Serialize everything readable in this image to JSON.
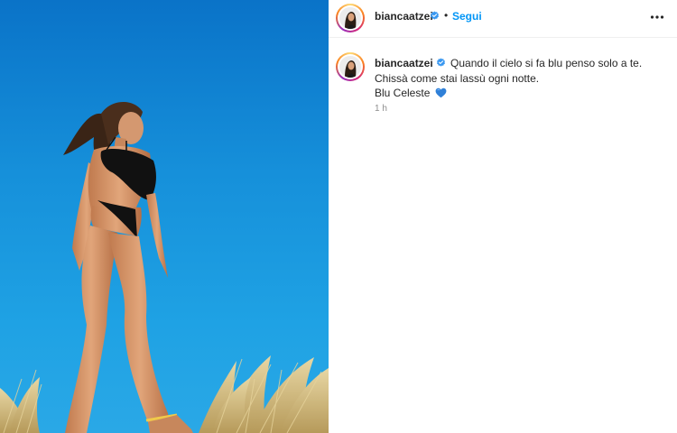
{
  "post": {
    "username": "biancaatzei",
    "follow_label": "Segui",
    "separator": "•",
    "more_icon": "more-horizontal-icon",
    "verified_icon": "verified-badge-icon"
  },
  "caption": {
    "username": "biancaatzei",
    "lines": [
      "Quando il cielo si fa blu penso solo a te.",
      "Chissà come stai lassù ogni notte.",
      "Blu Celeste"
    ],
    "emoji": "blue-heart-icon",
    "timestamp": "1 h"
  },
  "colors": {
    "link_blue": "#0095f6",
    "sky_blue": "#1690da",
    "verified_blue": "#3897f0",
    "heart_blue": "#2f80d8"
  }
}
